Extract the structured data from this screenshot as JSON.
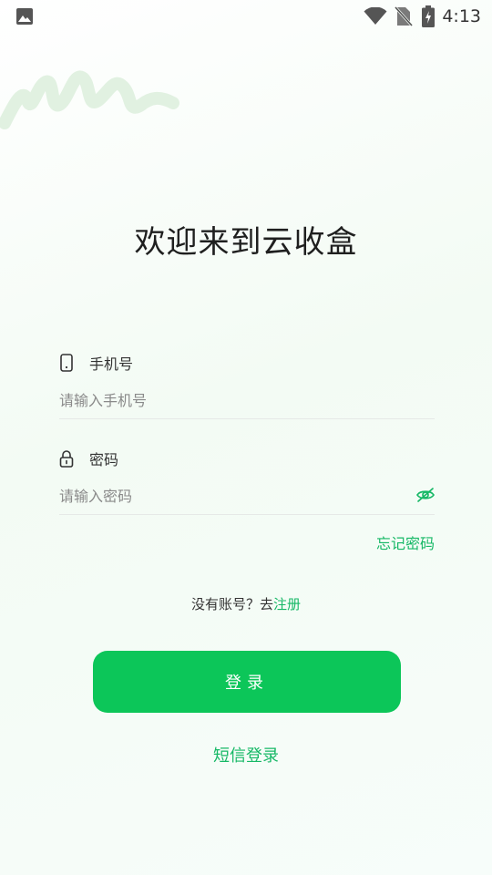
{
  "status_bar": {
    "time": "4:13",
    "icons": [
      "gallery-icon",
      "wifi-icon",
      "no-sim-icon",
      "battery-charging-icon"
    ]
  },
  "welcome_title": "欢迎来到云收盒",
  "phone": {
    "label": "手机号",
    "placeholder": "请输入手机号",
    "value": "",
    "icon": "phone-icon"
  },
  "password": {
    "label": "密码",
    "placeholder": "请输入密码",
    "value": "",
    "icon": "lock-icon",
    "toggle_icon": "eye-off-icon"
  },
  "forgot_password": "忘记密码",
  "register": {
    "prompt": "没有账号？去",
    "link": "注册"
  },
  "login_button": "登录",
  "sms_login": "短信登录",
  "colors": {
    "accent": "#16b866",
    "button": "#0cc659"
  }
}
